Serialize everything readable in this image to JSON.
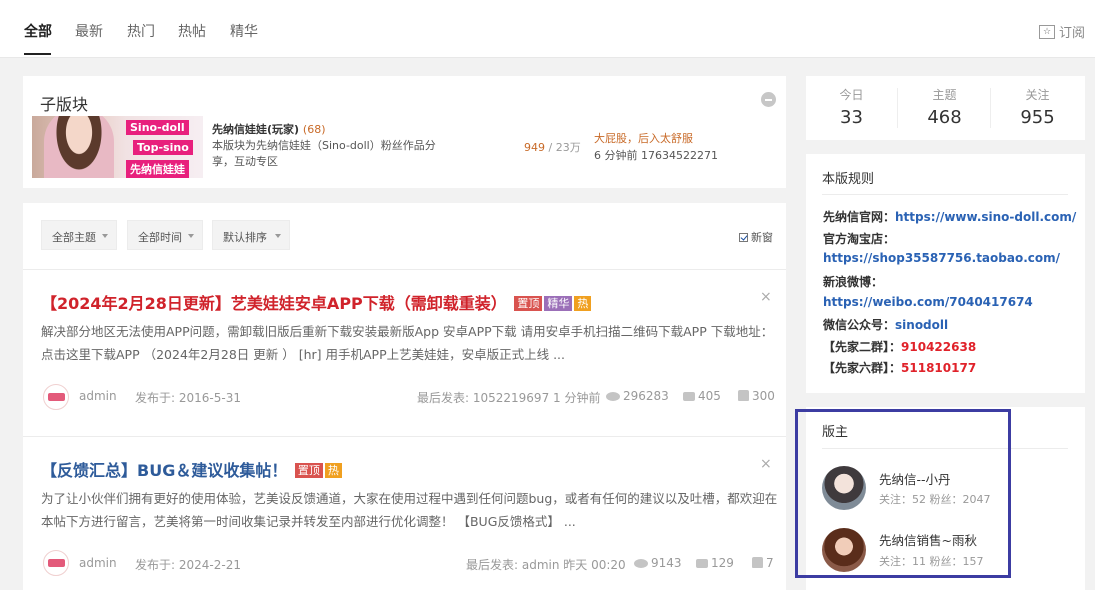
{
  "tabs": [
    "全部",
    "最新",
    "热门",
    "热帖",
    "精华"
  ],
  "subscribe_label": "订阅",
  "subforum": {
    "title": "子版块",
    "banner": {
      "line1": "Sino-doll",
      "line2": "Top-sino",
      "line3": "先纳信娃娃"
    },
    "name": "先纳信娃娃(玩家)",
    "count": "(68)",
    "desc": "本版块为先纳信娃娃（Sino-doll）粉丝作品分享，互动专区",
    "threads": "949",
    "posts": "/ 23万",
    "last_title": "大屁股，后入太舒服",
    "last_time": "6 分钟前 17634522271"
  },
  "filters": [
    "全部主题",
    "全部时间",
    "默认排序"
  ],
  "new_window": "新窗",
  "posts": [
    {
      "title": "【2024年2月28日更新】艺美娃娃安卓APP下载（需卸载重装）",
      "tags": [
        "置顶",
        "精华",
        "热"
      ],
      "excerpt": "解决部分地区无法使用APP问题，需卸载旧版后重新下载安装最新版App 安卓APP下载 请用安卓手机扫描二维码下载APP 下载地址：点击这里下载APP （2024年2月28日 更新 ） [hr] 用手机APP上艺美娃娃，安卓版正式上线 ...",
      "author": "admin",
      "published": "发布于: 2016-5-31",
      "last": "最后发表: 1052219697  1 分钟前",
      "views": "296283",
      "replies": "405",
      "likes": "300"
    },
    {
      "title": "【反馈汇总】BUG＆建议收集帖！",
      "tags": [
        "置顶",
        "热"
      ],
      "excerpt": "为了让小伙伴们拥有更好的使用体验，艺美设反馈通道，大家在使用过程中遇到任何问题bug，或者有任何的建议以及吐槽，都欢迎在本帖下方进行留言，艺美将第一时间收集记录并转发至内部进行优化调整！ 【BUG反馈格式】 ...",
      "author": "admin",
      "published": "发布于: 2024-2-21",
      "last": "最后发表: admin  昨天 00:20",
      "views": "9143",
      "replies": "129",
      "likes": "7"
    }
  ],
  "stats": [
    {
      "label": "今日",
      "value": "33"
    },
    {
      "label": "主题",
      "value": "468"
    },
    {
      "label": "关注",
      "value": "955"
    }
  ],
  "rules": {
    "title": "本版规则",
    "official_site_label": "先纳信官网：",
    "official_site_url": "https://www.sino-doll.com/",
    "taobao_label": "官方淘宝店：",
    "taobao_url": "https://shop35587756.taobao.com/",
    "weibo_label": "新浪微博：",
    "weibo_url": "https://weibo.com/7040417674",
    "wechat_label": "微信公众号：",
    "wechat_value": "sinodoll",
    "group2_label": "【先家二群】：",
    "group2_value": "910422638",
    "group6_label": "【先家六群】：",
    "group6_value": "511810177"
  },
  "moderators": {
    "title": "版主",
    "list": [
      {
        "name": "先纳信--小丹",
        "info": "关注：52  粉丝：2047"
      },
      {
        "name": "先纳信销售~雨秋",
        "info": "关注：11  粉丝：157"
      }
    ]
  },
  "colors": {
    "accent_red": "#d0232b",
    "link_blue": "#2a62b4",
    "highlight": "#3c3ca2"
  }
}
